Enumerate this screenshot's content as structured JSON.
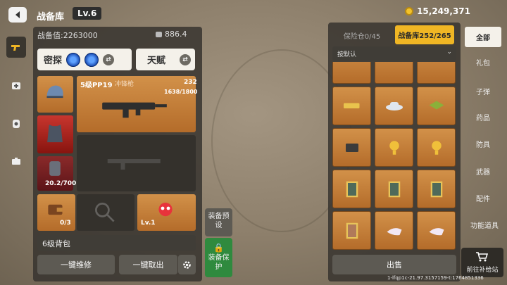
{
  "header": {
    "title": "战备库",
    "level": "Lv.6",
    "currency": "15,249,371"
  },
  "loadout": {
    "power_label": "战备值:2263000",
    "weight": "886.4",
    "tab_explore": "密探",
    "tab_talent": "天赋",
    "weapon1_name": "5级PP19",
    "weapon1_type": "冲锋枪",
    "weapon1_ammo": "232",
    "weapon1_durability": "1638/1800",
    "bag_capacity": "20.2/700",
    "backpack_count": "0/3",
    "pet_level": "Lv.1",
    "backpack_name": "6级背包",
    "repair_all": "一键维修",
    "unload_all": "一键取出",
    "preset_label": "装备预设",
    "protect_label": "装备保护"
  },
  "storage": {
    "tab_safe": "保险仓0/45",
    "tab_store": "战备库252/265",
    "sort_default": "按默认",
    "sell": "出售"
  },
  "categories": [
    "全部",
    "礼包",
    "子弹",
    "药品",
    "防具",
    "武器",
    "配件",
    "功能道具"
  ],
  "supply_label": "前往补给站",
  "footer_id": "1-lfqp1c-21.97.3157159-t:1764851336"
}
